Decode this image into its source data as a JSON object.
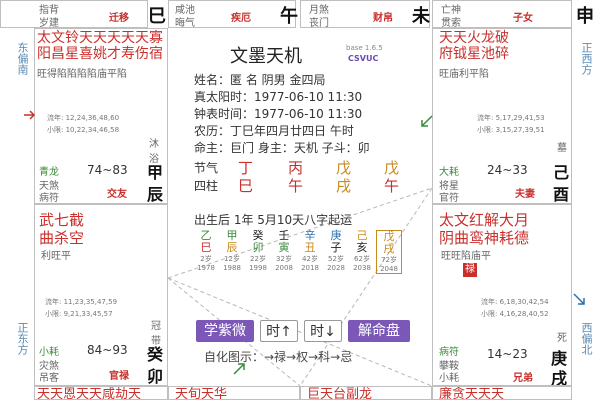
{
  "top_row": [
    {
      "left_text": "指背",
      "left_sub": "岁建",
      "red_label": "迁移",
      "big": "巳"
    },
    {
      "left_text": "咸池",
      "left_sub": "晦气",
      "red_label": "疾厄",
      "big": "午"
    },
    {
      "left_text": "月煞",
      "left_sub": "丧门",
      "red_label": "财帛",
      "big": "未"
    },
    {
      "left_text": "亡神",
      "left_sub": "贯索",
      "red_label": "子女",
      "big": "申"
    }
  ],
  "side_labels": {
    "left_top": "东偏南",
    "left_bottom": "正东方",
    "right_top": "正西方",
    "right_bottom": "西偏北"
  },
  "palace_tl": {
    "stars": [
      "太文铃天天天天天寡",
      "阳昌星喜姚才寿伤宿"
    ],
    "brightness": "旺得陷陷陷陷庙平陷",
    "decade_label": "流年: 12,24,36,48,60",
    "small_limit": "小限: 10,22,34,46,58",
    "god1": "沐浴",
    "left1": "青龙",
    "left2": "天煞",
    "left3": "病符",
    "range": "74~83",
    "palace": "交友",
    "stem": "甲",
    "branch": "辰"
  },
  "palace_tr": {
    "stars": [
      "天天火龙破",
      "府钺星池碎"
    ],
    "brightness": "旺庙利平陷",
    "decade_label": "流年: 5,17,29,41,53",
    "small_limit": "小限: 3,15,27,39,51",
    "god1": "墓",
    "left1": "大耗",
    "left2": "将星",
    "left3": "官符",
    "range": "24~33",
    "palace": "夫妻",
    "stem": "己",
    "branch": "酉"
  },
  "palace_ml": {
    "stars": [
      "武七截",
      "曲杀空"
    ],
    "brightness": "利旺平",
    "decade_label": "流年: 11,23,35,47,59",
    "small_limit": "小限: 9,21,33,45,57",
    "god1": "冠带",
    "left1": "小耗",
    "left2": "灾煞",
    "left3": "吊客",
    "range": "84~93",
    "palace": "官禄",
    "stem": "癸",
    "branch": "卯"
  },
  "palace_mr": {
    "stars": [
      "太文红解大月",
      "阴曲鸾神耗德"
    ],
    "brightness": "旺旺陷庙平",
    "badge": "禄",
    "decade_label": "流年: 6,18,30,42,54",
    "small_limit": "小限: 4,16,28,40,52",
    "god1": "死",
    "left1": "病符",
    "left2": "攀鞍",
    "left3": "小耗",
    "range": "14~23",
    "palace": "兄弟",
    "stem": "庚",
    "branch": "戌"
  },
  "bottom_row": [
    "天天恩天天咸劫天",
    "天旬天华",
    "巨天台副龙",
    "廉贪天天天"
  ],
  "center": {
    "title": "文墨天机",
    "version": "base 1.6.5",
    "brand": "CSVUC",
    "name_line": "姓名：匿 名        阴男 金四局",
    "solar_line": "真太阳时：1977-06-10 11:30",
    "clock_line": "钟表时间：1977-06-10 11:30",
    "lunar_line": "农历：丁巳年四月廿四日 午时",
    "master_line": "命主：巨门 身主：天机 子斗：卯",
    "jieqi_label": "节气",
    "sizhu_label": "四柱",
    "jieqi": [
      "丁",
      "丙",
      "戊",
      "戊"
    ],
    "sizhu": [
      "巳",
      "午",
      "戌",
      "午"
    ],
    "qiyun_line": "出生后 1年 5月10天八字起运",
    "dayun_stems": [
      "乙",
      "甲",
      "癸",
      "壬",
      "辛",
      "庚",
      "己",
      "戊"
    ],
    "dayun_branches": [
      "巳",
      "辰",
      "卯",
      "寅",
      "丑",
      "子",
      "亥",
      "戌"
    ],
    "dayun_ages": [
      "2岁",
      "12岁",
      "22岁",
      "32岁",
      "42岁",
      "52岁",
      "62岁",
      "72岁"
    ],
    "dayun_years": [
      "1978",
      "1988",
      "1998",
      "2008",
      "2018",
      "2028",
      "2038",
      "2048"
    ],
    "buttons": {
      "ziwei": "学紫微",
      "time_prev": "时↑",
      "time_next": "时↓",
      "interpret": "解命盘"
    },
    "legend": "自化图示：→禄→权→科→忌"
  }
}
